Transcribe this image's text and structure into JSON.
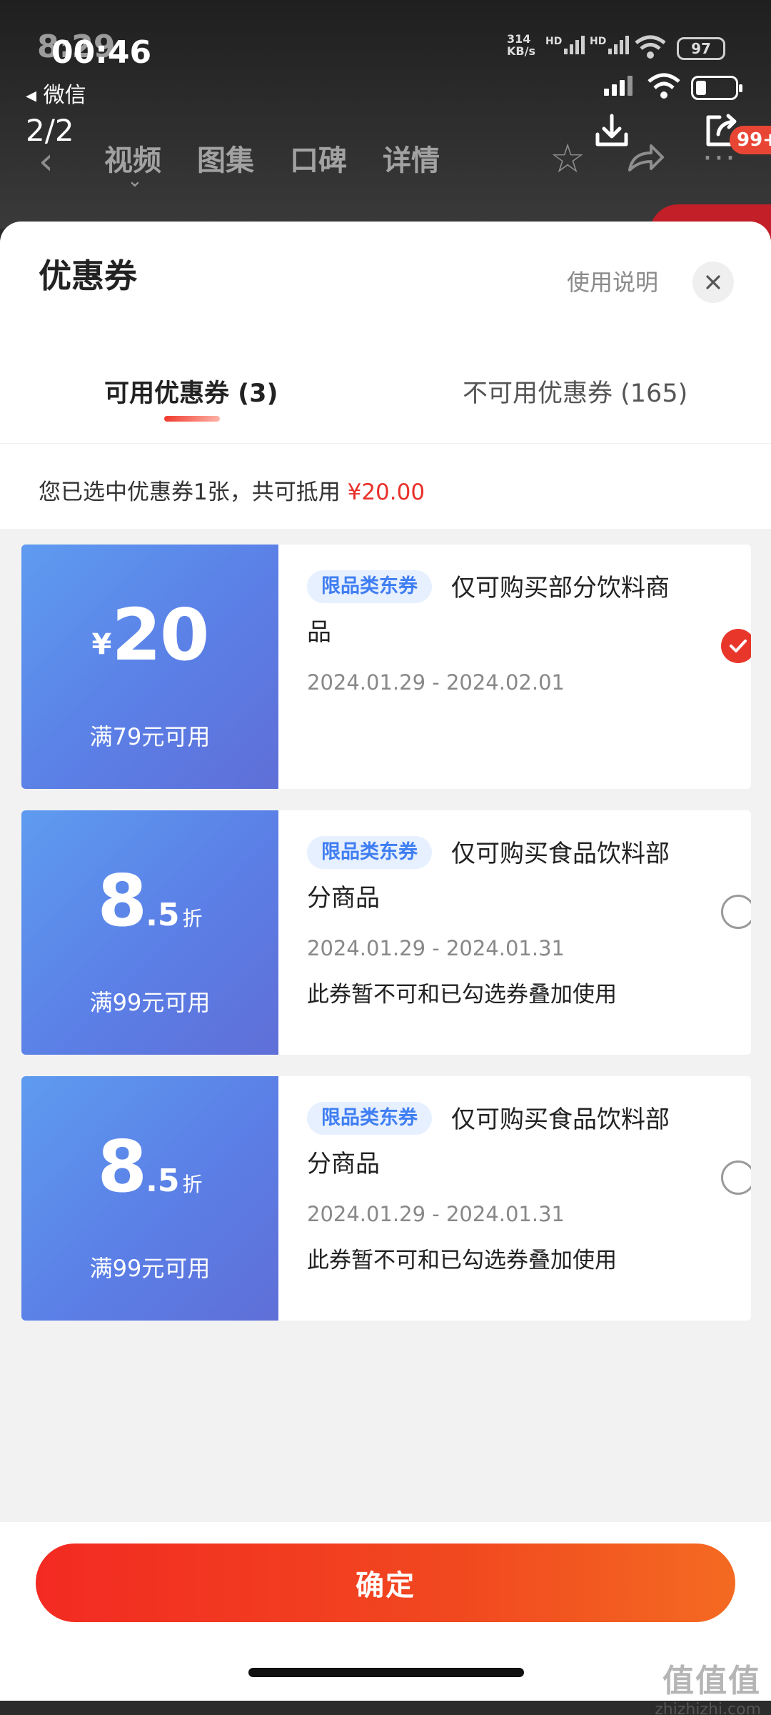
{
  "status_bar": {
    "time_ghost": "8:29",
    "time": "00:46",
    "back_app": "◂ 微信",
    "net_speed_value": "314",
    "net_speed_unit": "KB/s",
    "hd1": "HD",
    "hd2": "HD",
    "battery_left": "97"
  },
  "viewer": {
    "page_indicator": "2/2"
  },
  "nav": {
    "tabs": [
      "视频",
      "图集",
      "口碑",
      "详情"
    ],
    "badge": "99+"
  },
  "sheet": {
    "title": "优惠券",
    "help_link": "使用说明",
    "tab_available": "可用优惠券 (3)",
    "tab_unavailable": "不可用优惠券 (165)",
    "summary_prefix": "您已选中优惠券1张，共可抵用",
    "summary_amount": "¥20.00"
  },
  "coupons": [
    {
      "currency": "¥",
      "value": "20",
      "threshold": "满79元可用",
      "tag": "限品类东券",
      "desc": "仅可购买部分饮料商品",
      "dates": "2024.01.29 - 2024.02.01",
      "note": "",
      "selected": true
    },
    {
      "value_int": "8",
      "value_dec": ".5",
      "unit": "折",
      "threshold": "满99元可用",
      "tag": "限品类东券",
      "desc": "仅可购买食品饮料部分商品",
      "dates": "2024.01.29 - 2024.01.31",
      "note": "此券暂不可和已勾选券叠加使用",
      "selected": false
    },
    {
      "value_int": "8",
      "value_dec": ".5",
      "unit": "折",
      "threshold": "满99元可用",
      "tag": "限品类东券",
      "desc": "仅可购买食品饮料部分商品",
      "dates": "2024.01.29 - 2024.01.31",
      "note": "此券暂不可和已勾选券叠加使用",
      "selected": false
    }
  ],
  "footer": {
    "confirm_label": "确定"
  },
  "watermark": {
    "logo": "值值值",
    "url": "zhizhizhi.com"
  },
  "colors": {
    "accent_red": "#e9362b",
    "coupon_blue": "#5b7fe6",
    "tag_blue": "#3f7ef3"
  }
}
